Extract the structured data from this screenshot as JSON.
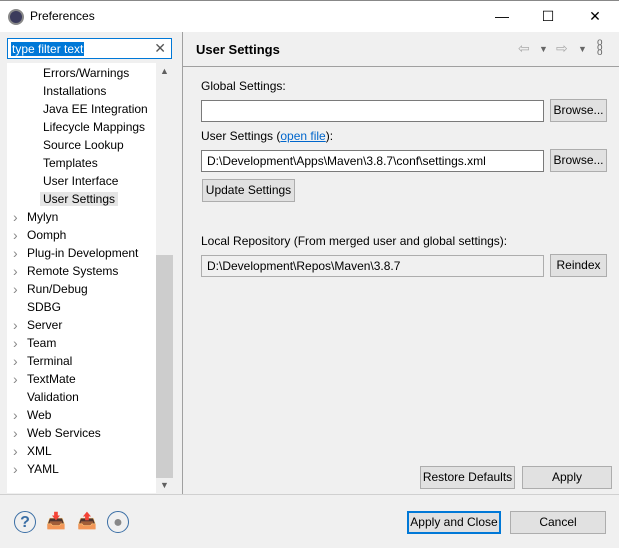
{
  "window": {
    "title": "Preferences",
    "minimize": "—",
    "maximize": "☐",
    "close": "✕"
  },
  "filter": {
    "value": "type filter text"
  },
  "tree": {
    "items": [
      {
        "label": "Errors/Warnings",
        "level": 1,
        "expandable": false
      },
      {
        "label": "Installations",
        "level": 1,
        "expandable": false
      },
      {
        "label": "Java EE Integration",
        "level": 1,
        "expandable": false
      },
      {
        "label": "Lifecycle Mappings",
        "level": 1,
        "expandable": false
      },
      {
        "label": "Source Lookup",
        "level": 1,
        "expandable": false
      },
      {
        "label": "Templates",
        "level": 1,
        "expandable": false
      },
      {
        "label": "User Interface",
        "level": 1,
        "expandable": false
      },
      {
        "label": "User Settings",
        "level": 1,
        "expandable": false,
        "selected": true
      },
      {
        "label": "Mylyn",
        "level": 0,
        "expandable": true
      },
      {
        "label": "Oomph",
        "level": 0,
        "expandable": true
      },
      {
        "label": "Plug-in Development",
        "level": 0,
        "expandable": true
      },
      {
        "label": "Remote Systems",
        "level": 0,
        "expandable": true
      },
      {
        "label": "Run/Debug",
        "level": 0,
        "expandable": true
      },
      {
        "label": "SDBG",
        "level": 0,
        "expandable": false
      },
      {
        "label": "Server",
        "level": 0,
        "expandable": true
      },
      {
        "label": "Team",
        "level": 0,
        "expandable": true
      },
      {
        "label": "Terminal",
        "level": 0,
        "expandable": true
      },
      {
        "label": "TextMate",
        "level": 0,
        "expandable": true
      },
      {
        "label": "Validation",
        "level": 0,
        "expandable": false
      },
      {
        "label": "Web",
        "level": 0,
        "expandable": true
      },
      {
        "label": "Web Services",
        "level": 0,
        "expandable": true
      },
      {
        "label": "XML",
        "level": 0,
        "expandable": true
      },
      {
        "label": "YAML",
        "level": 0,
        "expandable": true
      }
    ]
  },
  "page": {
    "title": "User Settings",
    "global_label": "Global Settings:",
    "global_value": "",
    "browse": "Browse...",
    "user_label_pre": "User Settings (",
    "user_link": "open file",
    "user_label_post": "):",
    "user_value": "D:\\Development\\Apps\\Maven\\3.8.7\\conf\\settings.xml",
    "update": "Update Settings",
    "local_label": "Local Repository (From merged user and global settings):",
    "local_value": "D:\\Development\\Repos\\Maven\\3.8.7",
    "reindex": "Reindex",
    "restore": "Restore Defaults",
    "apply": "Apply"
  },
  "footer": {
    "apply_close": "Apply and Close",
    "cancel": "Cancel"
  }
}
